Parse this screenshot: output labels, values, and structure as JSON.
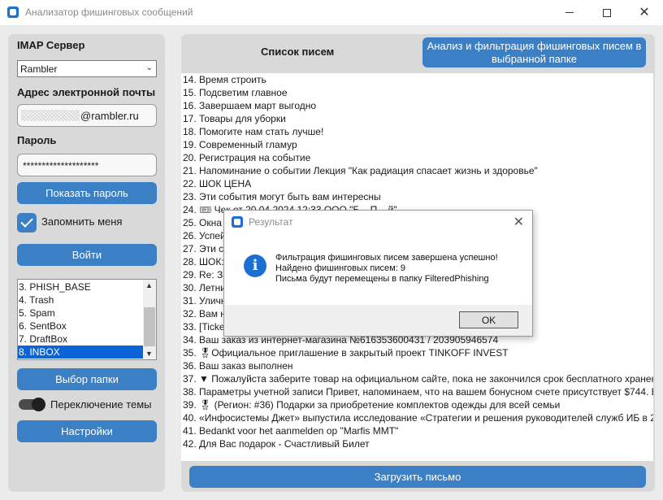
{
  "window": {
    "title": "Анализатор фишинговых сообщений"
  },
  "left": {
    "imap_label": "IMAP Сервер",
    "imap_value": "Rambler",
    "email_label": "Адрес электронной почты",
    "email_domain": "@rambler.ru",
    "password_label": "Пароль",
    "password_value": "********************",
    "show_password": "Показать пароль",
    "remember_me": "Запомнить меня",
    "login": "Войти",
    "folders": [
      "3. PHISH_BASE",
      "4. Trash",
      "5. Spam",
      "6. SentBox",
      "7. DraftBox",
      "8. INBOX"
    ],
    "selected_folder": "8. INBOX",
    "select_folder": "Выбор папки",
    "theme_toggle": "Переключение темы",
    "settings": "Настройки"
  },
  "right": {
    "list_title": "Список писем",
    "analyze_button": "Анализ и фильтрация фишинговых писем в выбранной папке",
    "load_button": "Загрузить письмо",
    "emails": [
      "14. Время строить",
      "15. Подсветим главное",
      "16. Завершаем март выгодно",
      "17. Товары для уборки",
      "18. Помогите нам стать лучше!",
      "19. Современный гламур",
      "20. Регистрация на событие",
      "21. Напоминание о событии Лекция \"Как радиация спасает жизнь и здоровье\"",
      "22. ШОК ЦЕНА",
      "23. Эти события могут быть вам интересны",
      "24. 🎟 Чек от 20.04.2024 12:33 ООО \"Б... П... й\"",
      "25. Окна",
      "26. Успей",
      "27. Эти со",
      "28. ШОК:",
      "29. Re: За",
      "30. Летни",
      "31. Улична",
      "32. Вам н",
      "33. [Ticket",
      "34. Ваш заказ из интернет-магазина №616353600431 / 203905946574",
      "35. 🎖Официальное приглашение в закрытый проект TINKOFF INVEST",
      "36. Ваш заказ выполнен",
      "37. ▼ Пожалуйста заберите товар на официальном сайте, пока не закончился срок бесплатного хранен",
      "38. Параметры учетной записи Привет, напоминаем, что на вашем бонусном счете присутствует $744. Е",
      "39. 🎖 (Регион: #36) Подарки за приобретение комплектов одежды для всей семьи",
      "40. «Инфосистемы Джет» выпустила исследование «Стратегии и решения руководителей служб ИБ в 20",
      "41. Bedankt voor het aanmelden op \"Marfis MMT\"",
      "42. Для Вас подарок - Счастливый Билет"
    ]
  },
  "dialog": {
    "title": "Результат",
    "line1": "Фильтрация фишинговых писем завершена успешно!",
    "line2": "Найдено фишинговых писем: 9",
    "line3": "Письма будут перемещены в папку FilteredPhishing",
    "ok": "OK"
  }
}
